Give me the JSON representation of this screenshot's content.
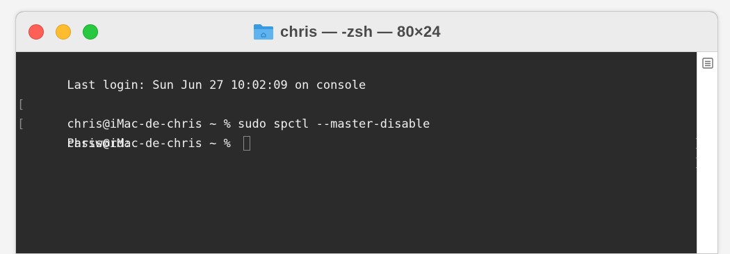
{
  "window": {
    "title": "chris — -zsh — 80×24",
    "folder_icon": "folder-icon",
    "colors": {
      "close": "#fe5f57",
      "minimize": "#febc2e",
      "zoom": "#28c840",
      "terminal_bg": "#2b2b2b",
      "terminal_text": "#efefef"
    }
  },
  "terminal": {
    "lines": [
      "Last login: Sun Jun 27 10:02:09 on console",
      "chris@iMac-de-chris ~ % sudo spctl --master-disable",
      "Password:",
      "chris@iMac-de-chris ~ % "
    ]
  },
  "scrollbar": {
    "icon": "list-icon"
  }
}
